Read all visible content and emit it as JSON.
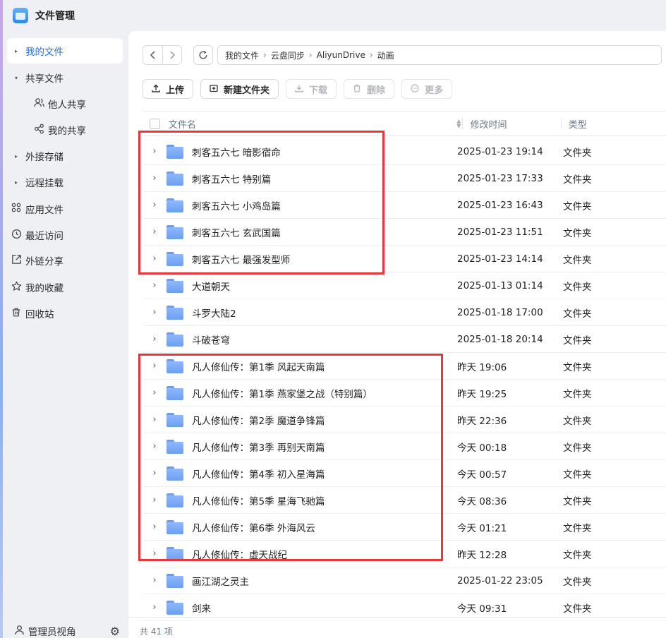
{
  "app": {
    "title": "文件管理"
  },
  "sidebar": {
    "items": [
      {
        "label": "我的文件",
        "icon": "caret-right-icon",
        "active": true
      },
      {
        "label": "共享文件",
        "icon": "caret-down-icon"
      },
      {
        "label": "他人共享",
        "icon": "users-icon"
      },
      {
        "label": "我的共享",
        "icon": "share-icon"
      },
      {
        "label": "外接存储",
        "icon": "caret-right-icon"
      },
      {
        "label": "远程挂载",
        "icon": "caret-right-icon"
      },
      {
        "label": "应用文件",
        "icon": "apps-icon"
      },
      {
        "label": "最近访问",
        "icon": "clock-icon"
      },
      {
        "label": "外链分享",
        "icon": "link-share-icon"
      },
      {
        "label": "我的收藏",
        "icon": "star-icon"
      },
      {
        "label": "回收站",
        "icon": "trash-icon"
      }
    ],
    "footer_label": "管理员视角"
  },
  "breadcrumb": [
    "我的文件",
    "云盘同步",
    "AliyunDrive",
    "动画"
  ],
  "toolbar": {
    "upload": "上传",
    "new_folder": "新建文件夹",
    "download": "下载",
    "delete": "删除",
    "more": "更多"
  },
  "table": {
    "headers": {
      "name": "文件名",
      "time": "修改时间",
      "type": "类型"
    },
    "rows": [
      {
        "name": "刺客五六七 暗影宿命",
        "time": "2025-01-23 19:14",
        "type": "文件夹"
      },
      {
        "name": "刺客五六七 特别篇",
        "time": "2025-01-23 17:33",
        "type": "文件夹"
      },
      {
        "name": "刺客五六七 小鸡岛篇",
        "time": "2025-01-23 16:43",
        "type": "文件夹"
      },
      {
        "name": "刺客五六七 玄武国篇",
        "time": "2025-01-23 11:51",
        "type": "文件夹"
      },
      {
        "name": "刺客五六七 最强发型师",
        "time": "2025-01-23 14:14",
        "type": "文件夹"
      },
      {
        "name": "大道朝天",
        "time": "2025-01-13 01:14",
        "type": "文件夹"
      },
      {
        "name": "斗罗大陆2",
        "time": "2025-01-18 17:00",
        "type": "文件夹"
      },
      {
        "name": "斗破苍穹",
        "time": "2025-01-18 20:14",
        "type": "文件夹"
      },
      {
        "name": "凡人修仙传：第1季 风起天南篇",
        "time": "昨天 19:06",
        "type": "文件夹"
      },
      {
        "name": "凡人修仙传：第1季 燕家堡之战（特别篇）",
        "time": "昨天 19:25",
        "type": "文件夹"
      },
      {
        "name": "凡人修仙传：第2季 魔道争锋篇",
        "time": "昨天 22:36",
        "type": "文件夹"
      },
      {
        "name": "凡人修仙传：第3季 再别天南篇",
        "time": "今天 00:18",
        "type": "文件夹"
      },
      {
        "name": "凡人修仙传：第4季 初入星海篇",
        "time": "今天 00:57",
        "type": "文件夹"
      },
      {
        "name": "凡人修仙传：第5季 星海飞驰篇",
        "time": "今天 08:36",
        "type": "文件夹"
      },
      {
        "name": "凡人修仙传：第6季 外海风云",
        "time": "今天 01:21",
        "type": "文件夹"
      },
      {
        "name": "凡人修仙传：虚天战纪",
        "time": "昨天 12:28",
        "type": "文件夹"
      },
      {
        "name": "画江湖之灵主",
        "time": "2025-01-22 23:05",
        "type": "文件夹"
      },
      {
        "name": "剑来",
        "time": "今天 09:31",
        "type": "文件夹"
      }
    ]
  },
  "footer": {
    "count": "共 41 项"
  },
  "colors": {
    "accent": "#1f6fd6",
    "highlight": "#e8373c",
    "folder": "#7aa9f5"
  }
}
